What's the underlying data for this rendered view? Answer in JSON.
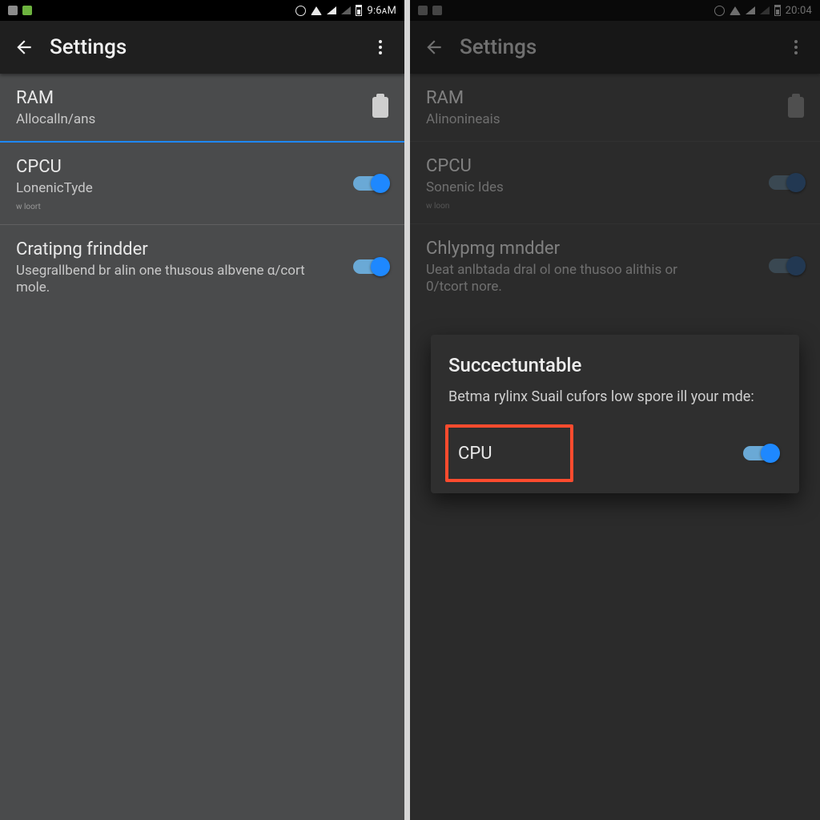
{
  "left": {
    "status": {
      "time": "9:6ᴀM"
    },
    "appbar": {
      "title": "Settings"
    },
    "rows": [
      {
        "title": "RAM",
        "sub": "Allocalln/ans"
      },
      {
        "title": "CPCU",
        "sub": "LonenicTyde",
        "tiny": "w loort"
      },
      {
        "title": "Cratipng frindder",
        "sub": "Usegrallbend br alin one thusous albvene α/cort mole."
      }
    ]
  },
  "right": {
    "status": {
      "time": "20:04"
    },
    "appbar": {
      "title": "Settings"
    },
    "rows": [
      {
        "title": "RAM",
        "sub": "Alinonineais"
      },
      {
        "title": "CPCU",
        "sub": "Sonenic Ides",
        "tiny": "w loon"
      },
      {
        "title": "Chlypmg mndder",
        "sub": "Ueat anlbtada dral ol one thusoo alithis or 0/tcort nore."
      }
    ],
    "dialog": {
      "title": "Succectuntable",
      "body": "Betma rylinx Suail cufors low spore ill your mde:",
      "option_label": "CPU"
    }
  }
}
